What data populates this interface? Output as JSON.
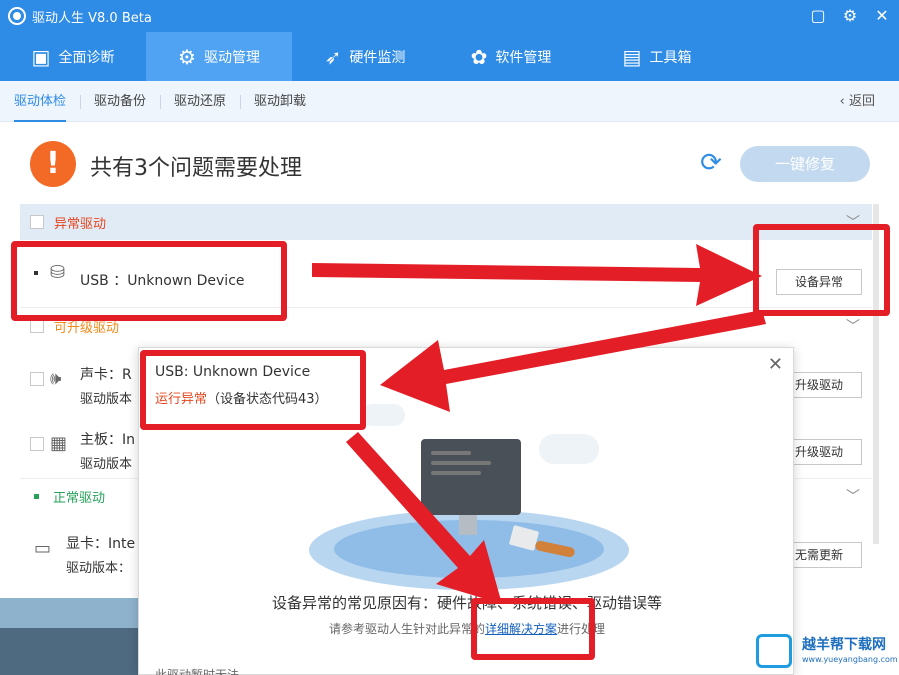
{
  "app": {
    "title": "驱动人生 V8.0 Beta",
    "icons": [
      "feedback-icon",
      "settings-icon",
      "close-icon"
    ]
  },
  "nav": {
    "items": [
      {
        "label": "全面诊断",
        "icon": "monitor-check-icon"
      },
      {
        "label": "驱动管理",
        "icon": "gear-icon"
      },
      {
        "label": "硬件监测",
        "icon": "rocket-icon"
      },
      {
        "label": "软件管理",
        "icon": "apps-icon"
      },
      {
        "label": "工具箱",
        "icon": "toolbox-icon"
      }
    ],
    "active": "驱动管理"
  },
  "subnav": {
    "items": [
      "驱动体检",
      "驱动备份",
      "驱动还原",
      "驱动卸载"
    ],
    "back": "返回"
  },
  "summary": {
    "title": "共有3个问题需要处理",
    "fix_label": "一键修复"
  },
  "sections": {
    "abnormal": "异常驱动",
    "upgradable": "可升级驱动",
    "normal": "正常驱动"
  },
  "drivers": {
    "usb": {
      "name": "USB ：Unknown Device",
      "button": "设备异常"
    },
    "sound": {
      "name": "声卡：R",
      "version": "驱动版本",
      "button": "升级驱动"
    },
    "board": {
      "name": "主板：In",
      "version": "驱动版本",
      "button": "升级驱动"
    },
    "gpu": {
      "name": "显卡：Inte",
      "version": "驱动版本：",
      "button": "无需更新"
    }
  },
  "popup": {
    "title": "USB: Unknown Device",
    "status_red": "运行异常",
    "status_code": "（设备状态代码43）",
    "reason": "设备异常的常见原因有：硬件故障、系统错误、驱动错误等",
    "hint_before": "请参考驱动人生针对此异常的",
    "hint_link": "详细解决方案",
    "hint_after": "进行处理",
    "footer": "此驱动暂时无法"
  },
  "watermark": {
    "name": "越羊帮下载网",
    "url": "www.yueyangbang.com"
  },
  "colors": {
    "brand": "#2e8be6",
    "alert": "#f26a25",
    "highlight": "#e31e26"
  }
}
